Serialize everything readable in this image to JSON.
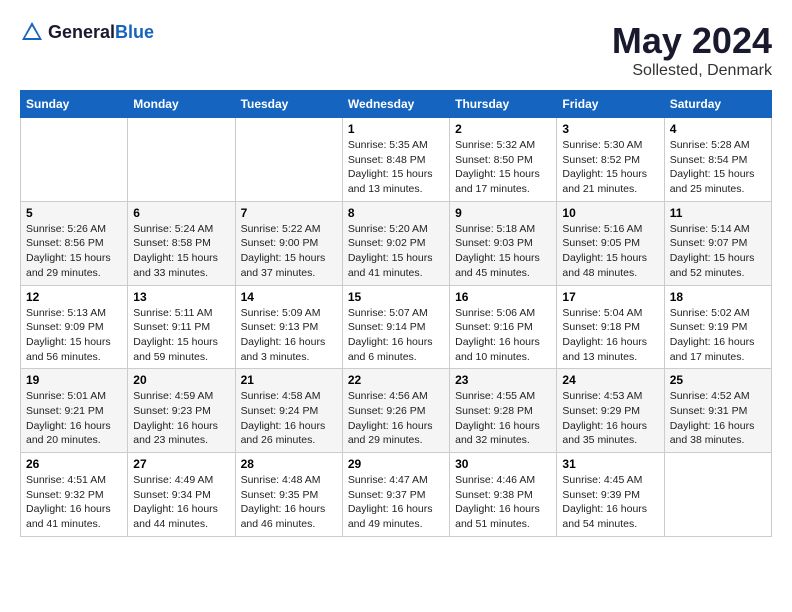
{
  "header": {
    "logo_general": "General",
    "logo_blue": "Blue",
    "month_year": "May 2024",
    "location": "Sollested, Denmark"
  },
  "weekdays": [
    "Sunday",
    "Monday",
    "Tuesday",
    "Wednesday",
    "Thursday",
    "Friday",
    "Saturday"
  ],
  "weeks": [
    [
      {
        "day": "",
        "detail": ""
      },
      {
        "day": "",
        "detail": ""
      },
      {
        "day": "",
        "detail": ""
      },
      {
        "day": "1",
        "detail": "Sunrise: 5:35 AM\nSunset: 8:48 PM\nDaylight: 15 hours\nand 13 minutes."
      },
      {
        "day": "2",
        "detail": "Sunrise: 5:32 AM\nSunset: 8:50 PM\nDaylight: 15 hours\nand 17 minutes."
      },
      {
        "day": "3",
        "detail": "Sunrise: 5:30 AM\nSunset: 8:52 PM\nDaylight: 15 hours\nand 21 minutes."
      },
      {
        "day": "4",
        "detail": "Sunrise: 5:28 AM\nSunset: 8:54 PM\nDaylight: 15 hours\nand 25 minutes."
      }
    ],
    [
      {
        "day": "5",
        "detail": "Sunrise: 5:26 AM\nSunset: 8:56 PM\nDaylight: 15 hours\nand 29 minutes."
      },
      {
        "day": "6",
        "detail": "Sunrise: 5:24 AM\nSunset: 8:58 PM\nDaylight: 15 hours\nand 33 minutes."
      },
      {
        "day": "7",
        "detail": "Sunrise: 5:22 AM\nSunset: 9:00 PM\nDaylight: 15 hours\nand 37 minutes."
      },
      {
        "day": "8",
        "detail": "Sunrise: 5:20 AM\nSunset: 9:02 PM\nDaylight: 15 hours\nand 41 minutes."
      },
      {
        "day": "9",
        "detail": "Sunrise: 5:18 AM\nSunset: 9:03 PM\nDaylight: 15 hours\nand 45 minutes."
      },
      {
        "day": "10",
        "detail": "Sunrise: 5:16 AM\nSunset: 9:05 PM\nDaylight: 15 hours\nand 48 minutes."
      },
      {
        "day": "11",
        "detail": "Sunrise: 5:14 AM\nSunset: 9:07 PM\nDaylight: 15 hours\nand 52 minutes."
      }
    ],
    [
      {
        "day": "12",
        "detail": "Sunrise: 5:13 AM\nSunset: 9:09 PM\nDaylight: 15 hours\nand 56 minutes."
      },
      {
        "day": "13",
        "detail": "Sunrise: 5:11 AM\nSunset: 9:11 PM\nDaylight: 15 hours\nand 59 minutes."
      },
      {
        "day": "14",
        "detail": "Sunrise: 5:09 AM\nSunset: 9:13 PM\nDaylight: 16 hours\nand 3 minutes."
      },
      {
        "day": "15",
        "detail": "Sunrise: 5:07 AM\nSunset: 9:14 PM\nDaylight: 16 hours\nand 6 minutes."
      },
      {
        "day": "16",
        "detail": "Sunrise: 5:06 AM\nSunset: 9:16 PM\nDaylight: 16 hours\nand 10 minutes."
      },
      {
        "day": "17",
        "detail": "Sunrise: 5:04 AM\nSunset: 9:18 PM\nDaylight: 16 hours\nand 13 minutes."
      },
      {
        "day": "18",
        "detail": "Sunrise: 5:02 AM\nSunset: 9:19 PM\nDaylight: 16 hours\nand 17 minutes."
      }
    ],
    [
      {
        "day": "19",
        "detail": "Sunrise: 5:01 AM\nSunset: 9:21 PM\nDaylight: 16 hours\nand 20 minutes."
      },
      {
        "day": "20",
        "detail": "Sunrise: 4:59 AM\nSunset: 9:23 PM\nDaylight: 16 hours\nand 23 minutes."
      },
      {
        "day": "21",
        "detail": "Sunrise: 4:58 AM\nSunset: 9:24 PM\nDaylight: 16 hours\nand 26 minutes."
      },
      {
        "day": "22",
        "detail": "Sunrise: 4:56 AM\nSunset: 9:26 PM\nDaylight: 16 hours\nand 29 minutes."
      },
      {
        "day": "23",
        "detail": "Sunrise: 4:55 AM\nSunset: 9:28 PM\nDaylight: 16 hours\nand 32 minutes."
      },
      {
        "day": "24",
        "detail": "Sunrise: 4:53 AM\nSunset: 9:29 PM\nDaylight: 16 hours\nand 35 minutes."
      },
      {
        "day": "25",
        "detail": "Sunrise: 4:52 AM\nSunset: 9:31 PM\nDaylight: 16 hours\nand 38 minutes."
      }
    ],
    [
      {
        "day": "26",
        "detail": "Sunrise: 4:51 AM\nSunset: 9:32 PM\nDaylight: 16 hours\nand 41 minutes."
      },
      {
        "day": "27",
        "detail": "Sunrise: 4:49 AM\nSunset: 9:34 PM\nDaylight: 16 hours\nand 44 minutes."
      },
      {
        "day": "28",
        "detail": "Sunrise: 4:48 AM\nSunset: 9:35 PM\nDaylight: 16 hours\nand 46 minutes."
      },
      {
        "day": "29",
        "detail": "Sunrise: 4:47 AM\nSunset: 9:37 PM\nDaylight: 16 hours\nand 49 minutes."
      },
      {
        "day": "30",
        "detail": "Sunrise: 4:46 AM\nSunset: 9:38 PM\nDaylight: 16 hours\nand 51 minutes."
      },
      {
        "day": "31",
        "detail": "Sunrise: 4:45 AM\nSunset: 9:39 PM\nDaylight: 16 hours\nand 54 minutes."
      },
      {
        "day": "",
        "detail": ""
      }
    ]
  ]
}
